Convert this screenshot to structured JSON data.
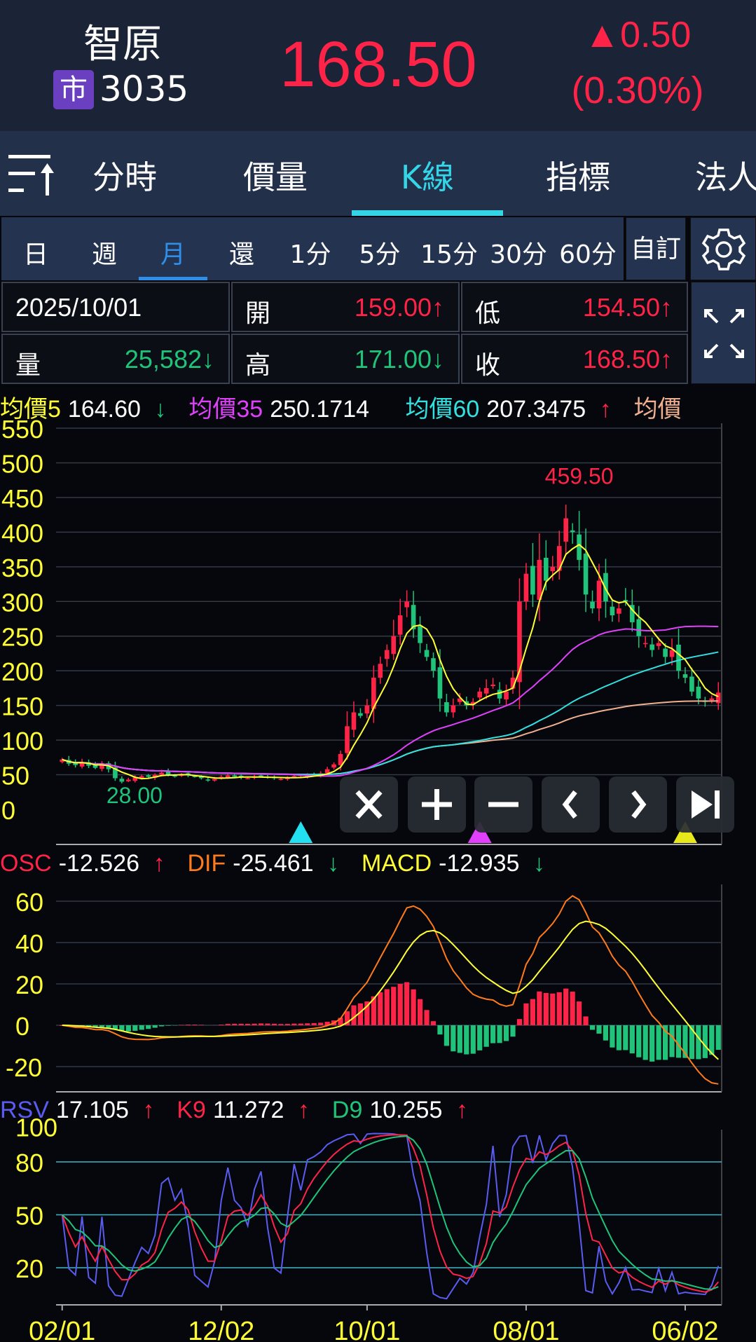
{
  "header": {
    "name": "智原",
    "market_badge": "市",
    "code": "3035",
    "price": "168.50",
    "change": "▲0.50",
    "change_pct": "(0.30%)"
  },
  "tabs": [
    {
      "label": "分時"
    },
    {
      "label": "價量"
    },
    {
      "label": "K線",
      "active": true
    },
    {
      "label": "指標"
    },
    {
      "label": "法人"
    }
  ],
  "periods": [
    {
      "label": "日"
    },
    {
      "label": "週"
    },
    {
      "label": "月",
      "active": true
    },
    {
      "label": "還"
    },
    {
      "label": "1分"
    },
    {
      "label": "5分"
    },
    {
      "label": "15分"
    },
    {
      "label": "30分"
    },
    {
      "label": "60分"
    }
  ],
  "custom_label": "自訂",
  "info": {
    "date": "2025/10/01",
    "open_label": "開",
    "open": "159.00↑",
    "low_label": "低",
    "low": "154.50↑",
    "vol_label": "量",
    "vol": "25,582↓",
    "high_label": "高",
    "high": "171.00↓",
    "close_label": "收",
    "close": "168.50↑"
  },
  "ma_legend": [
    {
      "label": "均價5",
      "value": "164.60",
      "arrow": "↓",
      "color": "#ffff33"
    },
    {
      "label": "均價35",
      "value": "250.1714",
      "arrow": "",
      "color": "#e040fb"
    },
    {
      "label": "均價60",
      "value": "207.3475",
      "arrow": "↑",
      "color": "#33e0e0"
    },
    {
      "label": "均價",
      "value": "",
      "arrow": "",
      "color": "#f0b090"
    }
  ],
  "macd_legend": [
    {
      "label": "OSC",
      "value": "-12.526",
      "arrow": "↑",
      "color": "#ff2348"
    },
    {
      "label": "DIF",
      "value": "-25.461",
      "arrow": "↓",
      "color": "#ff7a1a"
    },
    {
      "label": "MACD",
      "value": "-12.935",
      "arrow": "↓",
      "color": "#ffff33"
    }
  ],
  "kd_legend": [
    {
      "label": "RSV",
      "value": "17.105",
      "arrow": "↑",
      "color": "#5a5cf0"
    },
    {
      "label": "K9",
      "value": "11.272",
      "arrow": "↑",
      "color": "#ff2348"
    },
    {
      "label": "D9",
      "value": "10.255",
      "arrow": "↑",
      "color": "#1fc47a"
    }
  ],
  "colors": {
    "up": "#ff2348",
    "down": "#1fc47a",
    "axis": "#ffff33"
  },
  "chart_data": {
    "type": "candlestick",
    "price_ticks": [
      0,
      50,
      100,
      150,
      200,
      250,
      300,
      350,
      400,
      450,
      500,
      550
    ],
    "macd_ticks": [
      -20,
      0,
      20,
      40,
      60
    ],
    "kd_ticks": [
      20,
      50,
      80,
      100
    ],
    "x_labels": [
      {
        "label": "02/01",
        "index": 0
      },
      {
        "label": "12/02",
        "index": 24
      },
      {
        "label": "10/01",
        "index": 46
      },
      {
        "label": "08/01",
        "index": 70
      },
      {
        "label": "06/02",
        "index": 94
      }
    ],
    "annotations": [
      {
        "text": "459.50",
        "index": 78,
        "value": 459.5,
        "kind": "high"
      },
      {
        "text": "28.00",
        "index": 9,
        "value": 28,
        "kind": "low"
      }
    ],
    "close": [
      72,
      66,
      64,
      68,
      63,
      60,
      66,
      58,
      45,
      40,
      43,
      46,
      48,
      47,
      50,
      53,
      50,
      48,
      50,
      49,
      47,
      45,
      42,
      44,
      47,
      49,
      47,
      46,
      45,
      47,
      48,
      46,
      45,
      44,
      46,
      48,
      47,
      49,
      50,
      52,
      58,
      65,
      80,
      120,
      140,
      135,
      150,
      190,
      210,
      230,
      250,
      280,
      300,
      260,
      240,
      220,
      200,
      160,
      140,
      150,
      160,
      150,
      155,
      170,
      175,
      180,
      160,
      170,
      190,
      300,
      340,
      310,
      360,
      330,
      350,
      380,
      420,
      400,
      360,
      310,
      290,
      330,
      300,
      280,
      290,
      300,
      270,
      250,
      240,
      230,
      240,
      220,
      230,
      200,
      190,
      170,
      160,
      155,
      160,
      168.5
    ],
    "markers": [
      {
        "index": 36,
        "color": "#22e0f0"
      },
      {
        "index": 63,
        "color": "#e040fb"
      },
      {
        "index": 94,
        "color": "#e8e81a"
      }
    ]
  },
  "toolbar": [
    "close",
    "zoom-in",
    "zoom-out",
    "prev",
    "next",
    "last"
  ]
}
